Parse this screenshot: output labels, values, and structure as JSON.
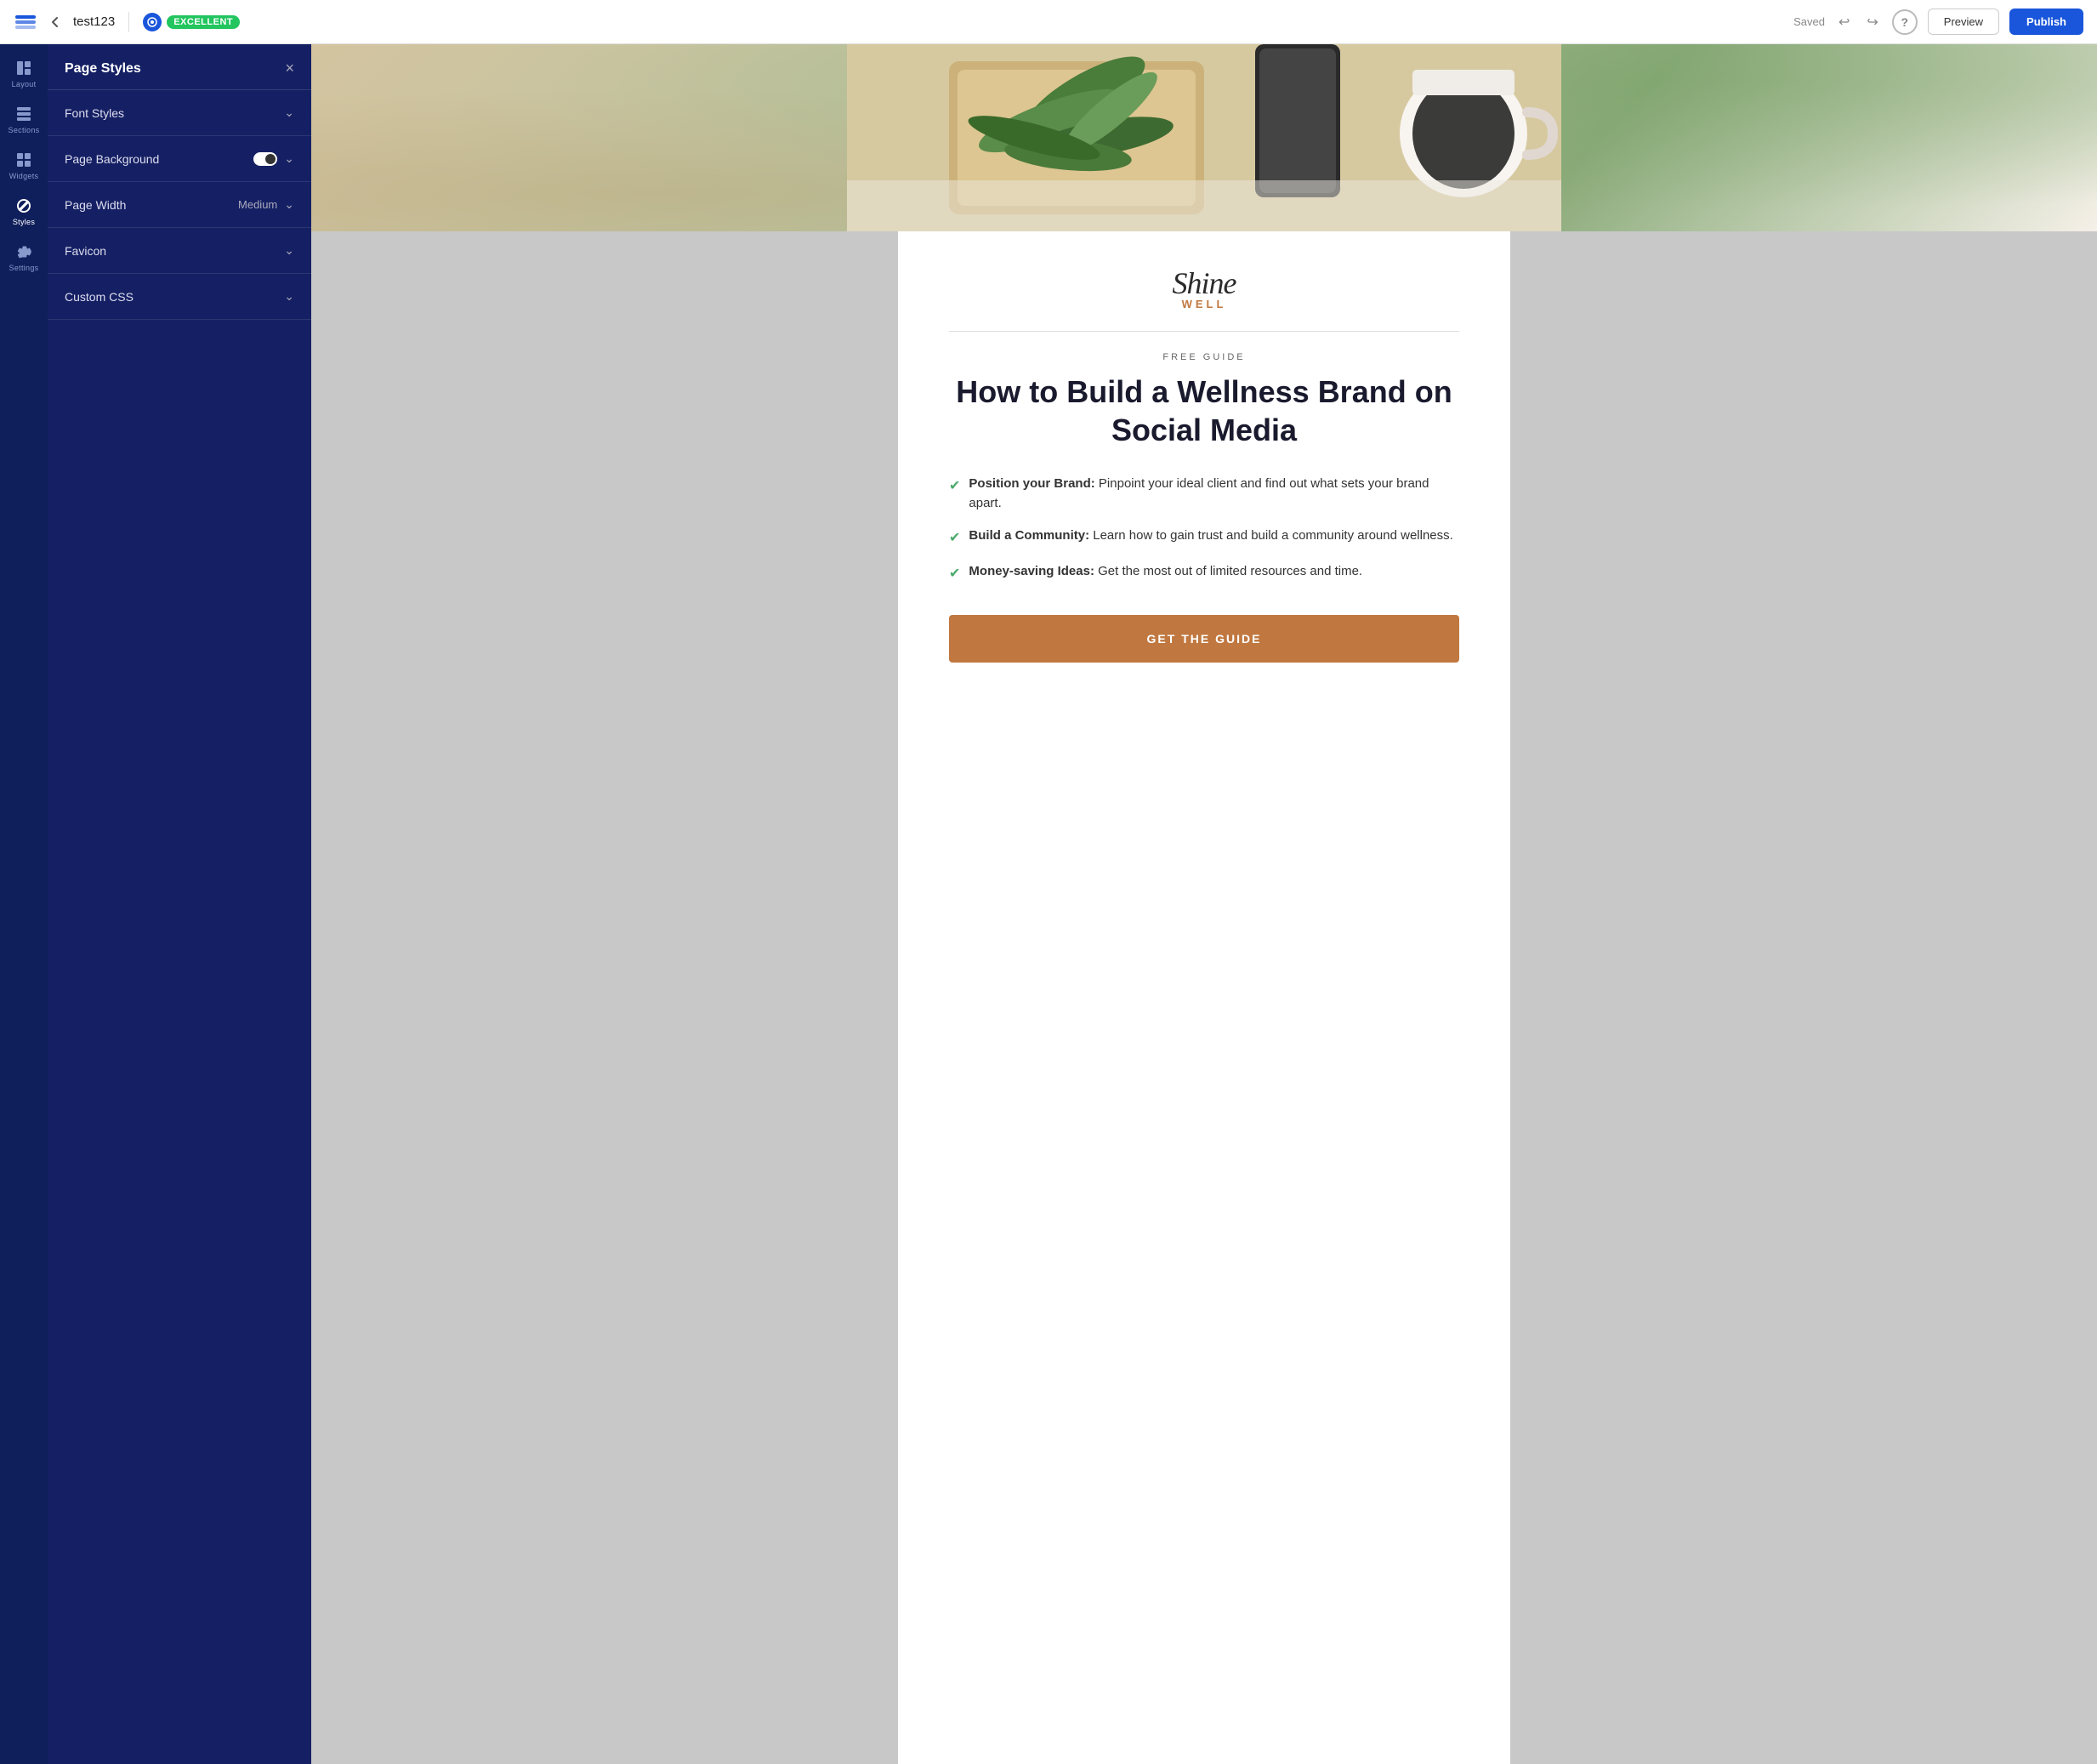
{
  "topbar": {
    "logo_alt": "layers-icon",
    "back_label": "←",
    "title": "test123",
    "score_icon_alt": "target-icon",
    "score_badge": "EXCELLENT",
    "saved_label": "Saved",
    "undo_label": "↩",
    "redo_label": "↪",
    "help_label": "?",
    "preview_label": "Preview",
    "publish_label": "Publish"
  },
  "icon_nav": {
    "items": [
      {
        "id": "layout",
        "label": "Layout",
        "active": false
      },
      {
        "id": "sections",
        "label": "Sections",
        "active": false
      },
      {
        "id": "widgets",
        "label": "Widgets",
        "active": false
      },
      {
        "id": "styles",
        "label": "Styles",
        "active": true
      },
      {
        "id": "settings",
        "label": "Settings",
        "active": false
      }
    ]
  },
  "side_panel": {
    "title": "Page Styles",
    "close_label": "×",
    "sections": [
      {
        "id": "font-styles",
        "label": "Font Styles",
        "has_toggle": false,
        "has_value": false,
        "value": ""
      },
      {
        "id": "page-background",
        "label": "Page Background",
        "has_toggle": true,
        "has_value": false,
        "value": ""
      },
      {
        "id": "page-width",
        "label": "Page Width",
        "has_toggle": false,
        "has_value": true,
        "value": "Medium"
      },
      {
        "id": "favicon",
        "label": "Favicon",
        "has_toggle": false,
        "has_value": false,
        "value": ""
      },
      {
        "id": "custom-css",
        "label": "Custom CSS",
        "has_toggle": false,
        "has_value": false,
        "value": ""
      }
    ]
  },
  "page_content": {
    "brand_name_script": "Shine",
    "brand_name_sub": "WELL",
    "guide_label": "FREE GUIDE",
    "guide_title": "How to Build a Wellness Brand on Social Media",
    "checklist": [
      {
        "bold": "Position your Brand:",
        "text": " Pinpoint your ideal client and find out what sets your brand apart."
      },
      {
        "bold": "Build a Community:",
        "text": " Learn how to gain trust and build a community around wellness."
      },
      {
        "bold": "Money-saving Ideas:",
        "text": " Get the most out of limited resources and time."
      }
    ],
    "cta_label": "GET THE GUIDE"
  }
}
